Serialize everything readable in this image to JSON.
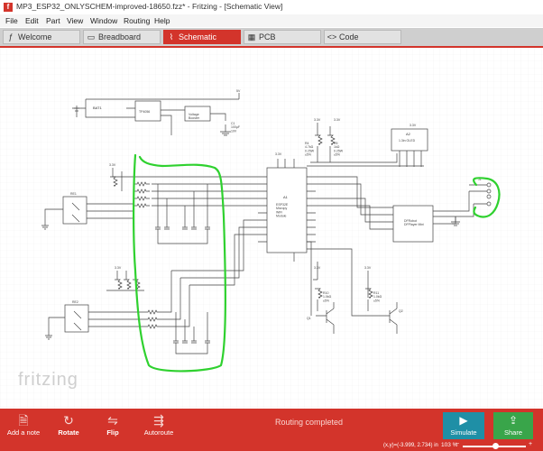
{
  "window": {
    "title": "MP3_ESP32_ONLYSCHEM-improved-18650.fzz* - Fritzing - [Schematic View]"
  },
  "menu": [
    "File",
    "Edit",
    "Part",
    "View",
    "Window",
    "Routing",
    "Help"
  ],
  "tabs": [
    {
      "label": "Welcome",
      "icon": "f-logo-icon"
    },
    {
      "label": "Breadboard",
      "icon": "breadboard-icon"
    },
    {
      "label": "Schematic",
      "icon": "schematic-icon",
      "active": true
    },
    {
      "label": "PCB",
      "icon": "pcb-icon"
    },
    {
      "label": "Code",
      "icon": "code-icon"
    }
  ],
  "schematic": {
    "watermark": "fritzing",
    "labels": {
      "bat": "BAT1",
      "tp": "TP4056",
      "boost": "Voltage\nBooster",
      "c_boost": "C1\n100µF\n10V",
      "esp_name": "ESP32E\nMicropy\nWiFi\nModule",
      "esp_ref": "A1",
      "oled_ref": "A2",
      "oled_name": "1.3in OLED",
      "dfp_name": "DFRobot\nDFPlayer Mini",
      "j1": "J1",
      "q1": "Q1",
      "q2": "Q2",
      "res_top": "R4\n4.7kΩ\n0.25W\n±5%",
      "res_mid": "R5\n1kΩ\n0.25W\n±5%",
      "res_q1": "R10\n1.0kΩ\n±5%",
      "res_q2": "R11\n1.0kΩ\n±5%",
      "sw1": "RE1",
      "sw2": "RE2",
      "v33": "3.3V",
      "v5": "5V",
      "gnd": "GND"
    }
  },
  "toolbar": {
    "add_note": "Add a note",
    "rotate": "Rotate",
    "flip": "Flip",
    "autoroute": "Autoroute",
    "status": "Routing completed",
    "simulate": "Simulate",
    "share": "Share",
    "coords": "(x,y)=(-3.999, 2.734) in",
    "zoom": "103 %"
  },
  "colors": {
    "accent": "#d3342b",
    "simulate": "#1f8fa6",
    "share": "#39a54a",
    "annotation": "#2fd12f"
  }
}
